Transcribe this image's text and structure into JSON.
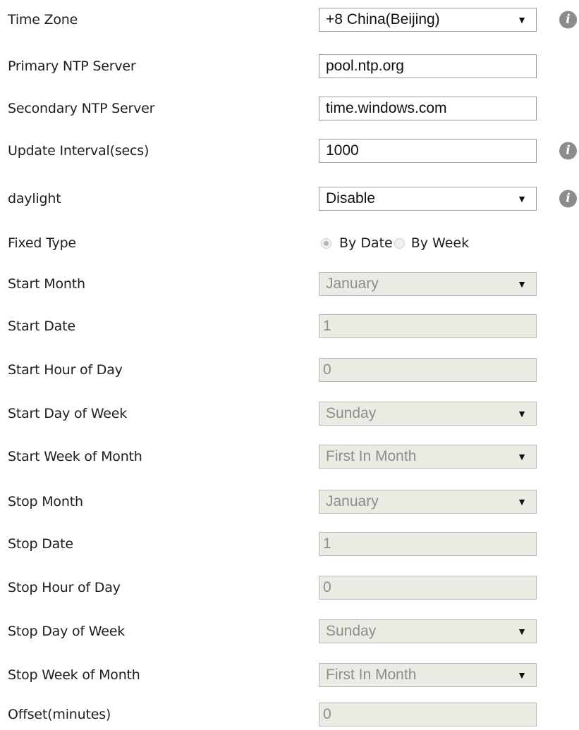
{
  "info_glyph": "i",
  "arrow_glyph": "▼",
  "time_zone": {
    "label": "Time Zone",
    "value": "+8 China(Beijing)"
  },
  "primary_ntp": {
    "label": "Primary NTP Server",
    "value": "pool.ntp.org"
  },
  "secondary_ntp": {
    "label": "Secondary NTP Server",
    "value": "time.windows.com"
  },
  "update_interval": {
    "label": "Update Interval(secs)",
    "value": "1000"
  },
  "daylight": {
    "label": "daylight",
    "value": "Disable"
  },
  "fixed_type": {
    "label": "Fixed Type",
    "option_by_date": "By Date",
    "option_by_week": "By Week",
    "selected": "By Date"
  },
  "start_month": {
    "label": "Start Month",
    "value": "January"
  },
  "start_date": {
    "label": "Start Date",
    "value": "1"
  },
  "start_hour": {
    "label": "Start Hour of Day",
    "value": "0"
  },
  "start_day_of_week": {
    "label": "Start Day of Week",
    "value": "Sunday"
  },
  "start_week_of_month": {
    "label": "Start Week of Month",
    "value": "First In Month"
  },
  "stop_month": {
    "label": "Stop Month",
    "value": "January"
  },
  "stop_date": {
    "label": "Stop Date",
    "value": "1"
  },
  "stop_hour": {
    "label": "Stop Hour of Day",
    "value": "0"
  },
  "stop_day_of_week": {
    "label": "Stop Day of Week",
    "value": "Sunday"
  },
  "stop_week_of_month": {
    "label": "Stop Week of Month",
    "value": "First In Month"
  },
  "offset": {
    "label": "Offset(minutes)",
    "value": "0"
  }
}
